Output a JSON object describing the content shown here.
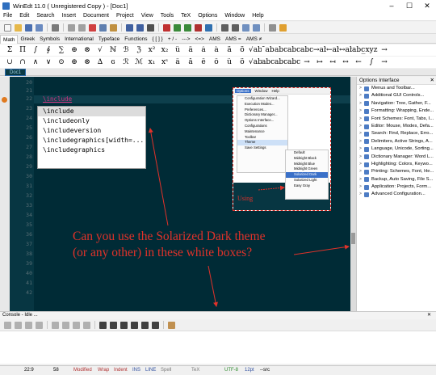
{
  "window": {
    "title": "WinEdt 11.0  ( Unregistered  Copy )  - [Doc1]",
    "min": "–",
    "max": "☐",
    "close": "✕"
  },
  "menu": [
    "File",
    "Edit",
    "Search",
    "Insert",
    "Document",
    "Project",
    "View",
    "Tools",
    "TeX",
    "Options",
    "Window",
    "Help"
  ],
  "symbol_tabs": [
    "Math",
    "Greek",
    "Symbols",
    "International",
    "Typeface",
    "Functions",
    "{ [ ] }",
    "+ / -",
    "--->",
    "<=>",
    "AMS",
    "AMS =",
    "AMS ≠"
  ],
  "symbols_row1": [
    "Σ",
    "Π",
    "∫",
    "∮",
    "∑",
    "⊕",
    "⊗",
    "√",
    "ℕ",
    "ℬ",
    "ℨ",
    "x²",
    "x₂",
    "û",
    "â",
    "á",
    "à",
    "ä",
    "ö",
    "√abc",
    "¯abc",
    "̃abc",
    "̂abc",
    "abc",
    "→abc",
    "←abc",
    "↔abc",
    "abc̲",
    "̲xyz",
    "→"
  ],
  "symbols_row2": [
    "∪",
    "∩",
    "∧",
    "∨",
    "⊙",
    "⊕",
    "⊗",
    "∆",
    "ɢ",
    "ℛ",
    "ℳ",
    "x₁",
    "xˢ",
    "â",
    "å",
    "ê",
    "ô",
    "û",
    "õ",
    "√abc",
    "̅abc",
    "̃abc",
    "̂abc",
    "→",
    "↦",
    "↤",
    "↔",
    "←",
    "∫",
    "→"
  ],
  "doc_tab": "Doc1",
  "editor": {
    "line_numbers": [
      20,
      21,
      22,
      23,
      24,
      25,
      26,
      27,
      28,
      29,
      30,
      31,
      32,
      33,
      34,
      35,
      36,
      37,
      38,
      39,
      40,
      41,
      42
    ],
    "current_line_text": "\\include",
    "completions": [
      "\\include",
      "\\includeonly",
      "\\includeversion",
      "\\includegraphics[width=...",
      "\\includegraphics"
    ]
  },
  "inset": {
    "menubar": [
      "Options",
      "Window",
      "Help"
    ],
    "dropdown": [
      "Configuration Wizard...",
      "Execution Modes...",
      "Preferences...",
      "Dictionary Manager...",
      "Options Interface...",
      "Configurations",
      "Maintenance",
      "Toolbar",
      "Theme",
      "Save Settings"
    ],
    "theme_submenu": [
      "Default",
      "Midnight Black",
      "Midnight Blue",
      "Midnight Green",
      "Solarized Dark",
      "Solarized Light",
      "Easy Gray"
    ],
    "label": "Using"
  },
  "caption": [
    "Can you use the Solarized Dark theme",
    "(or any other) in these white boxes?"
  ],
  "options_panel": {
    "title": "Options Interface",
    "items": [
      "Menus and Toolbar...",
      "Additional GUI Controls...",
      "Navigation: Tree, Gather, F...",
      "Formatting: Wrapping, Ende...",
      "Font Schemes: Font, Tabs, I...",
      "Editor: Mouse, Modes, Defa...",
      "Search: Find, Replace, Erro...",
      "Delimiters, Active Strings, A...",
      "Language, Unicode, Sorting...",
      "Dictionary Manager: Word L...",
      "Highlighting: Colors, Keywo...",
      "Printing: Schemes, Font, He...",
      "Backup, Auto Saving, File S...",
      "Application: Projects, Form...",
      "Advanced Configuration..."
    ]
  },
  "console": {
    "title": "Console - Idle ..."
  },
  "status": {
    "pos": "22:9",
    "col": "58",
    "modified": "Modified",
    "wrap": "Wrap",
    "indent": "Indent",
    "ins": "INS",
    "line": "LINE",
    "spell": "Spell",
    "tex": "TeX",
    "enc": "UTF-8",
    "size": "12pt",
    "src": "--src"
  }
}
